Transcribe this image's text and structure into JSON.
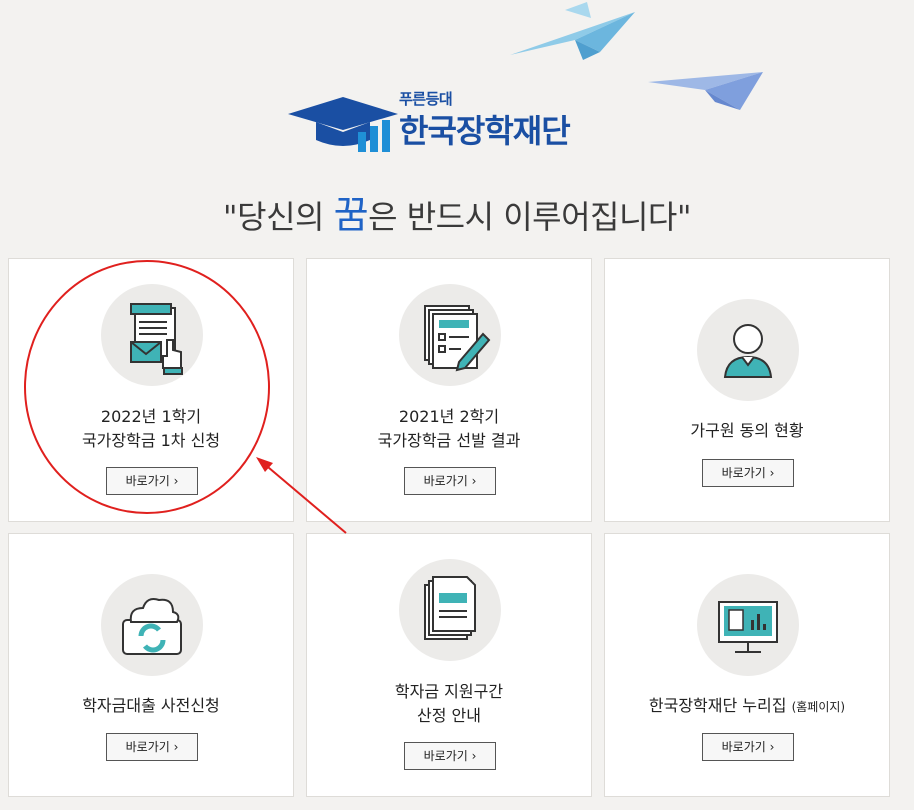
{
  "brand": {
    "small": "푸른등대",
    "name": "한국장학재단"
  },
  "slogan": {
    "before": "\"당신의 ",
    "emphasis": "꿈",
    "after": "은 반드시 이루어집니다\""
  },
  "accent_color": "#1a4fa3",
  "annotation_color": "#e0201e",
  "cards": [
    {
      "icon": "document-envelope-click-icon",
      "title_line1": "2022년 1학기",
      "title_line2": "국가장학금 1차 신청",
      "button": "바로가기 ›"
    },
    {
      "icon": "documents-pencil-icon",
      "title_line1": "2021년 2학기",
      "title_line2": "국가장학금 선발 결과",
      "button": "바로가기 ›"
    },
    {
      "icon": "person-icon",
      "title_line1": "가구원 동의 현황",
      "button": "바로가기 ›"
    },
    {
      "icon": "cloud-sync-device-icon",
      "title_line1": "학자금대출 사전신청",
      "button": "바로가기 ›"
    },
    {
      "icon": "documents-stack-icon",
      "title_line1": "학자금 지원구간",
      "title_line2": "산정 안내",
      "button": "바로가기 ›"
    },
    {
      "icon": "monitor-chart-icon",
      "title_line1": "한국장학재단 누리집",
      "title_suffix": "(홈페이지)",
      "button": "바로가기 ›"
    }
  ]
}
